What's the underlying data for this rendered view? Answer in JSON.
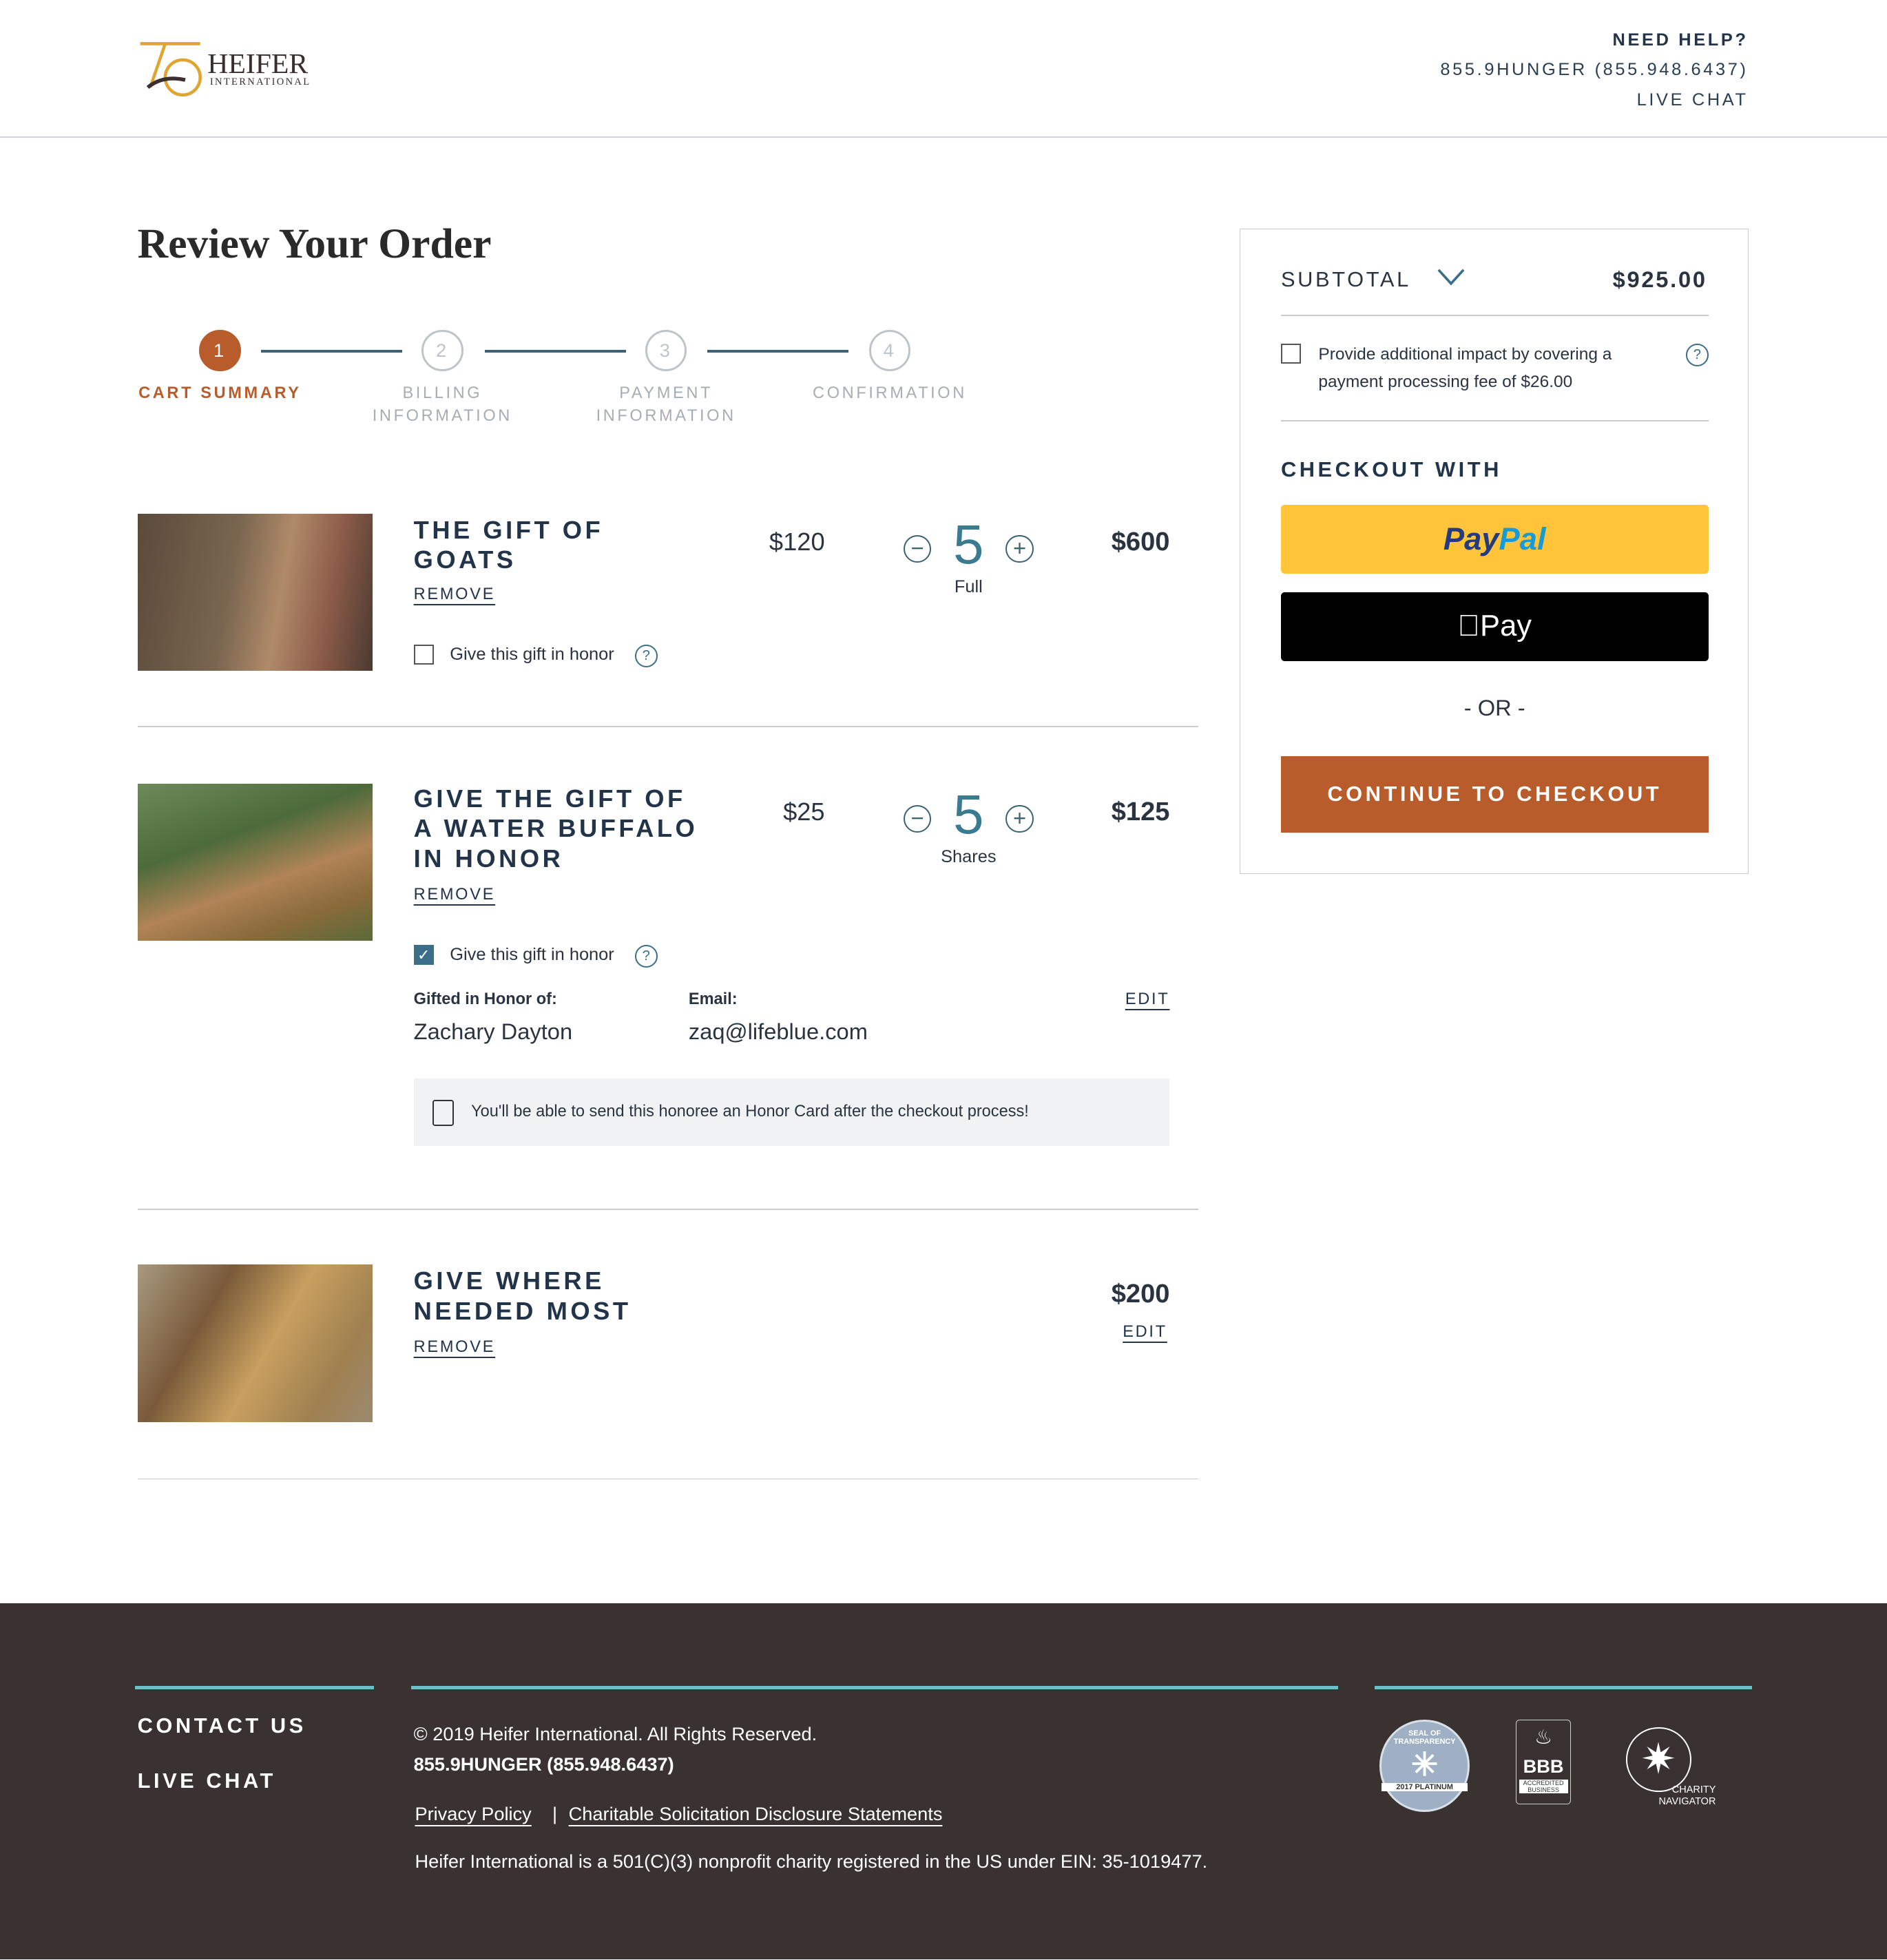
{
  "header": {
    "logo_text": "HEIFER",
    "logo_sub": "INTERNATIONAL",
    "logo_number": "75",
    "help_title": "NEED HELP?",
    "phone": "855.9HUNGER (855.948.6437)",
    "live_chat": "LIVE CHAT"
  },
  "page_title": "Review Your Order",
  "steps": [
    {
      "num": "1",
      "label": "CART SUMMARY",
      "active": true
    },
    {
      "num": "2",
      "label": "BILLING INFORMATION"
    },
    {
      "num": "3",
      "label": "PAYMENT INFORMATION"
    },
    {
      "num": "4",
      "label": "CONFIRMATION"
    }
  ],
  "items": [
    {
      "name": "THE GIFT OF GOATS",
      "remove": "REMOVE",
      "price": "$120",
      "qty": "5",
      "qty_unit": "Full",
      "total": "$600",
      "honor_label": "Give this gift in honor",
      "honor_checked": false
    },
    {
      "name": "GIVE THE GIFT OF A WATER BUFFALO IN HONOR",
      "remove": "REMOVE",
      "price": "$25",
      "qty": "5",
      "qty_unit": "Shares",
      "total": "$125",
      "honor_label": "Give this gift in honor",
      "honor_checked": true,
      "honoree_label": "Gifted in Honor of:",
      "honoree": "Zachary Dayton",
      "email_label": "Email:",
      "email": "zaq@lifeblue.com",
      "edit": "EDIT",
      "notice": "You'll be able to send this honoree an Honor Card after the checkout process!"
    },
    {
      "name": "GIVE WHERE NEEDED MOST",
      "remove": "REMOVE",
      "total": "$200",
      "edit": "EDIT"
    }
  ],
  "summary": {
    "subtotal_label": "SUBTOTAL",
    "subtotal": "$925.00",
    "fee_text": "Provide additional impact by covering a payment processing fee of $26.00",
    "checkout_with": "CHECKOUT WITH",
    "paypal_a": "Pay",
    "paypal_b": "Pal",
    "applepay": "Pay",
    "or": "- OR -",
    "continue": "CONTINUE TO CHECKOUT"
  },
  "colors": {
    "accent": "#b85c2c",
    "navy": "#22344a",
    "teal": "#3b7b92",
    "paypal": "#ffc439",
    "footer": "#3a3230",
    "footer_line": "#6cc0c9"
  },
  "footer": {
    "contact": "CONTACT US",
    "live_chat": "LIVE CHAT",
    "copyright": "© 2019 Heifer International. All Rights Reserved.",
    "phone": "855.9HUNGER (855.948.6437)",
    "privacy": "Privacy Policy",
    "sep": "|",
    "solicitation": "Charitable Solicitation Disclosure Statements",
    "ein": "Heifer International is a 501(C)(3) nonprofit charity registered in the US under EIN: 35-1019477.",
    "badges": {
      "guidestar_top": "SEAL OF TRANSPARENCY",
      "guidestar_bottom": "2017 PLATINUM",
      "bbb": "BBB",
      "bbb_sub": "ACCREDITED BUSINESS",
      "cn1": "CHARITY",
      "cn2": "NAVIGATOR"
    }
  }
}
